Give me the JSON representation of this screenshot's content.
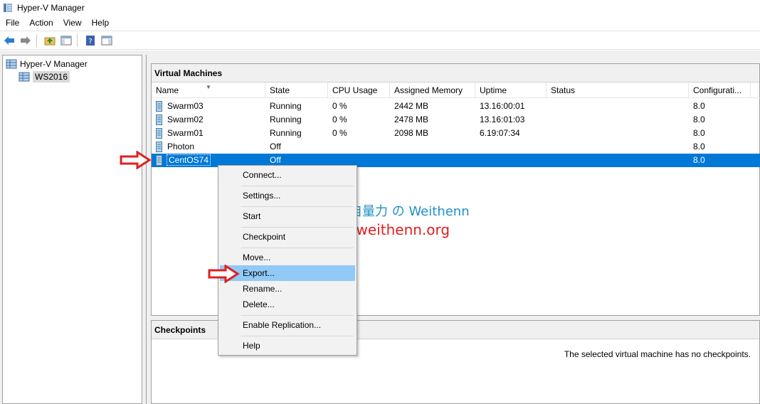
{
  "window": {
    "title": "Hyper-V Manager"
  },
  "menubar": {
    "items": [
      "File",
      "Action",
      "View",
      "Help"
    ]
  },
  "tree": {
    "root": "Hyper-V Manager",
    "child": "WS2016"
  },
  "vm_panel": {
    "title": "Virtual Machines",
    "columns": [
      "Name",
      "State",
      "CPU Usage",
      "Assigned Memory",
      "Uptime",
      "Status",
      "Configurati..."
    ],
    "rows": [
      {
        "name": "Swarm03",
        "state": "Running",
        "cpu": "0 %",
        "memory": "2442 MB",
        "uptime": "13.16:00:01",
        "status": "",
        "config": "8.0"
      },
      {
        "name": "Swarm02",
        "state": "Running",
        "cpu": "0 %",
        "memory": "2478 MB",
        "uptime": "13.16:01:03",
        "status": "",
        "config": "8.0"
      },
      {
        "name": "Swarm01",
        "state": "Running",
        "cpu": "0 %",
        "memory": "2098 MB",
        "uptime": "6.19:07:34",
        "status": "",
        "config": "8.0"
      },
      {
        "name": "Photon",
        "state": "Off",
        "cpu": "",
        "memory": "",
        "uptime": "",
        "status": "",
        "config": "8.0"
      },
      {
        "name": "CentOS74",
        "state": "Off",
        "cpu": "",
        "memory": "",
        "uptime": "",
        "status": "",
        "config": "8.0"
      }
    ]
  },
  "checkpoints_panel": {
    "title": "Checkpoints",
    "empty_message": "The selected virtual machine has no checkpoints."
  },
  "context_menu": {
    "items": [
      "Connect...",
      "Settings...",
      "Start",
      "Checkpoint",
      "Move...",
      "Export...",
      "Rename...",
      "Delete...",
      "Enable Replication...",
      "Help"
    ],
    "highlighted": "Export..."
  },
  "watermark": {
    "line1": "不自量力 の Weithenn",
    "line2": "weithenn.org"
  },
  "colors": {
    "selection": "#0078d7",
    "menu_highlight": "#91c9f7",
    "arrow": "#e02020",
    "watermark_blue": "#1e90c8"
  }
}
